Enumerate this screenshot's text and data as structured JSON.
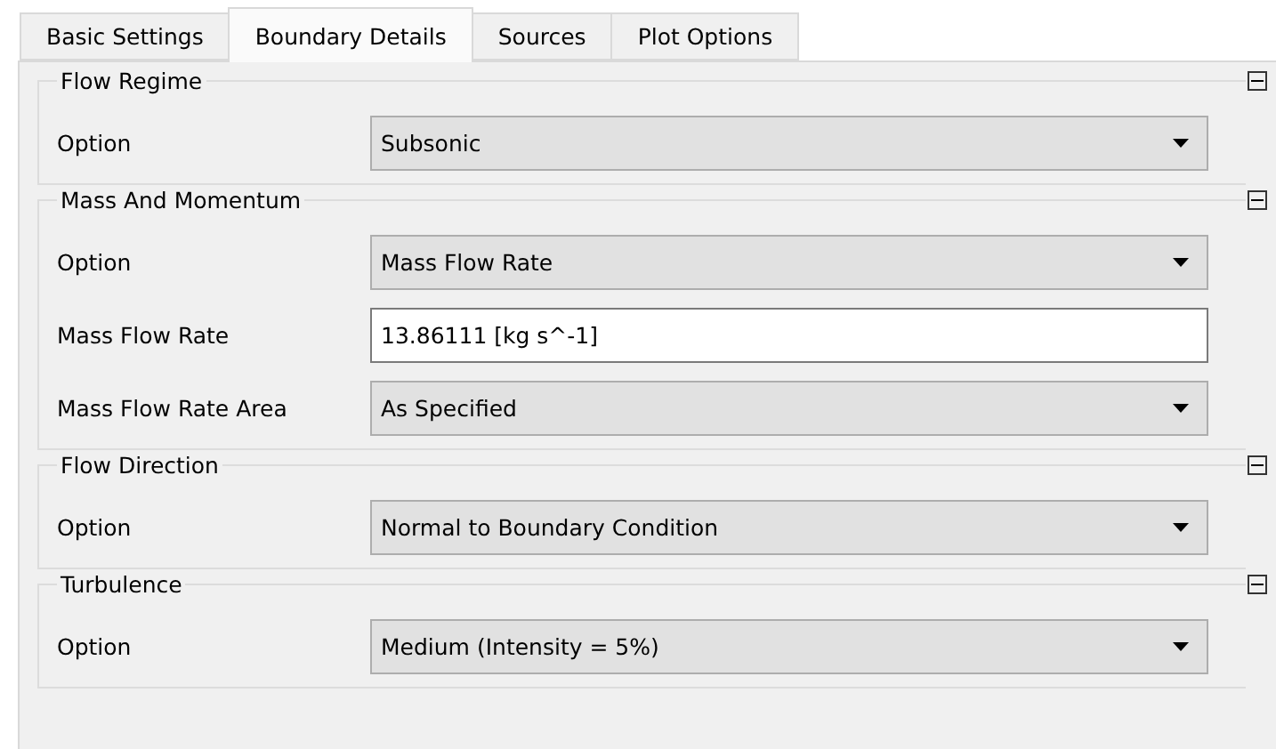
{
  "tabs": [
    {
      "label": "Basic Settings",
      "selected": false
    },
    {
      "label": "Boundary Details",
      "selected": true
    },
    {
      "label": "Sources",
      "selected": false
    },
    {
      "label": "Plot Options",
      "selected": false
    }
  ],
  "groups": [
    {
      "title": "Flow Regime",
      "expanded": true,
      "fields": [
        {
          "label": "Option",
          "kind": "dropdown",
          "value": "Subsonic"
        }
      ]
    },
    {
      "title": "Mass And Momentum",
      "expanded": true,
      "fields": [
        {
          "label": "Option",
          "kind": "dropdown",
          "value": "Mass Flow Rate"
        },
        {
          "label": "Mass Flow Rate",
          "kind": "text",
          "value": "13.86111 [kg s^-1]"
        },
        {
          "label": "Mass Flow Rate Area",
          "kind": "dropdown",
          "value": "As Specified"
        }
      ]
    },
    {
      "title": "Flow Direction",
      "expanded": true,
      "fields": [
        {
          "label": "Option",
          "kind": "dropdown",
          "value": "Normal to Boundary Condition"
        }
      ]
    },
    {
      "title": "Turbulence",
      "expanded": true,
      "fields": [
        {
          "label": "Option",
          "kind": "dropdown",
          "value": "Medium (Intensity = 5%)"
        }
      ]
    }
  ]
}
